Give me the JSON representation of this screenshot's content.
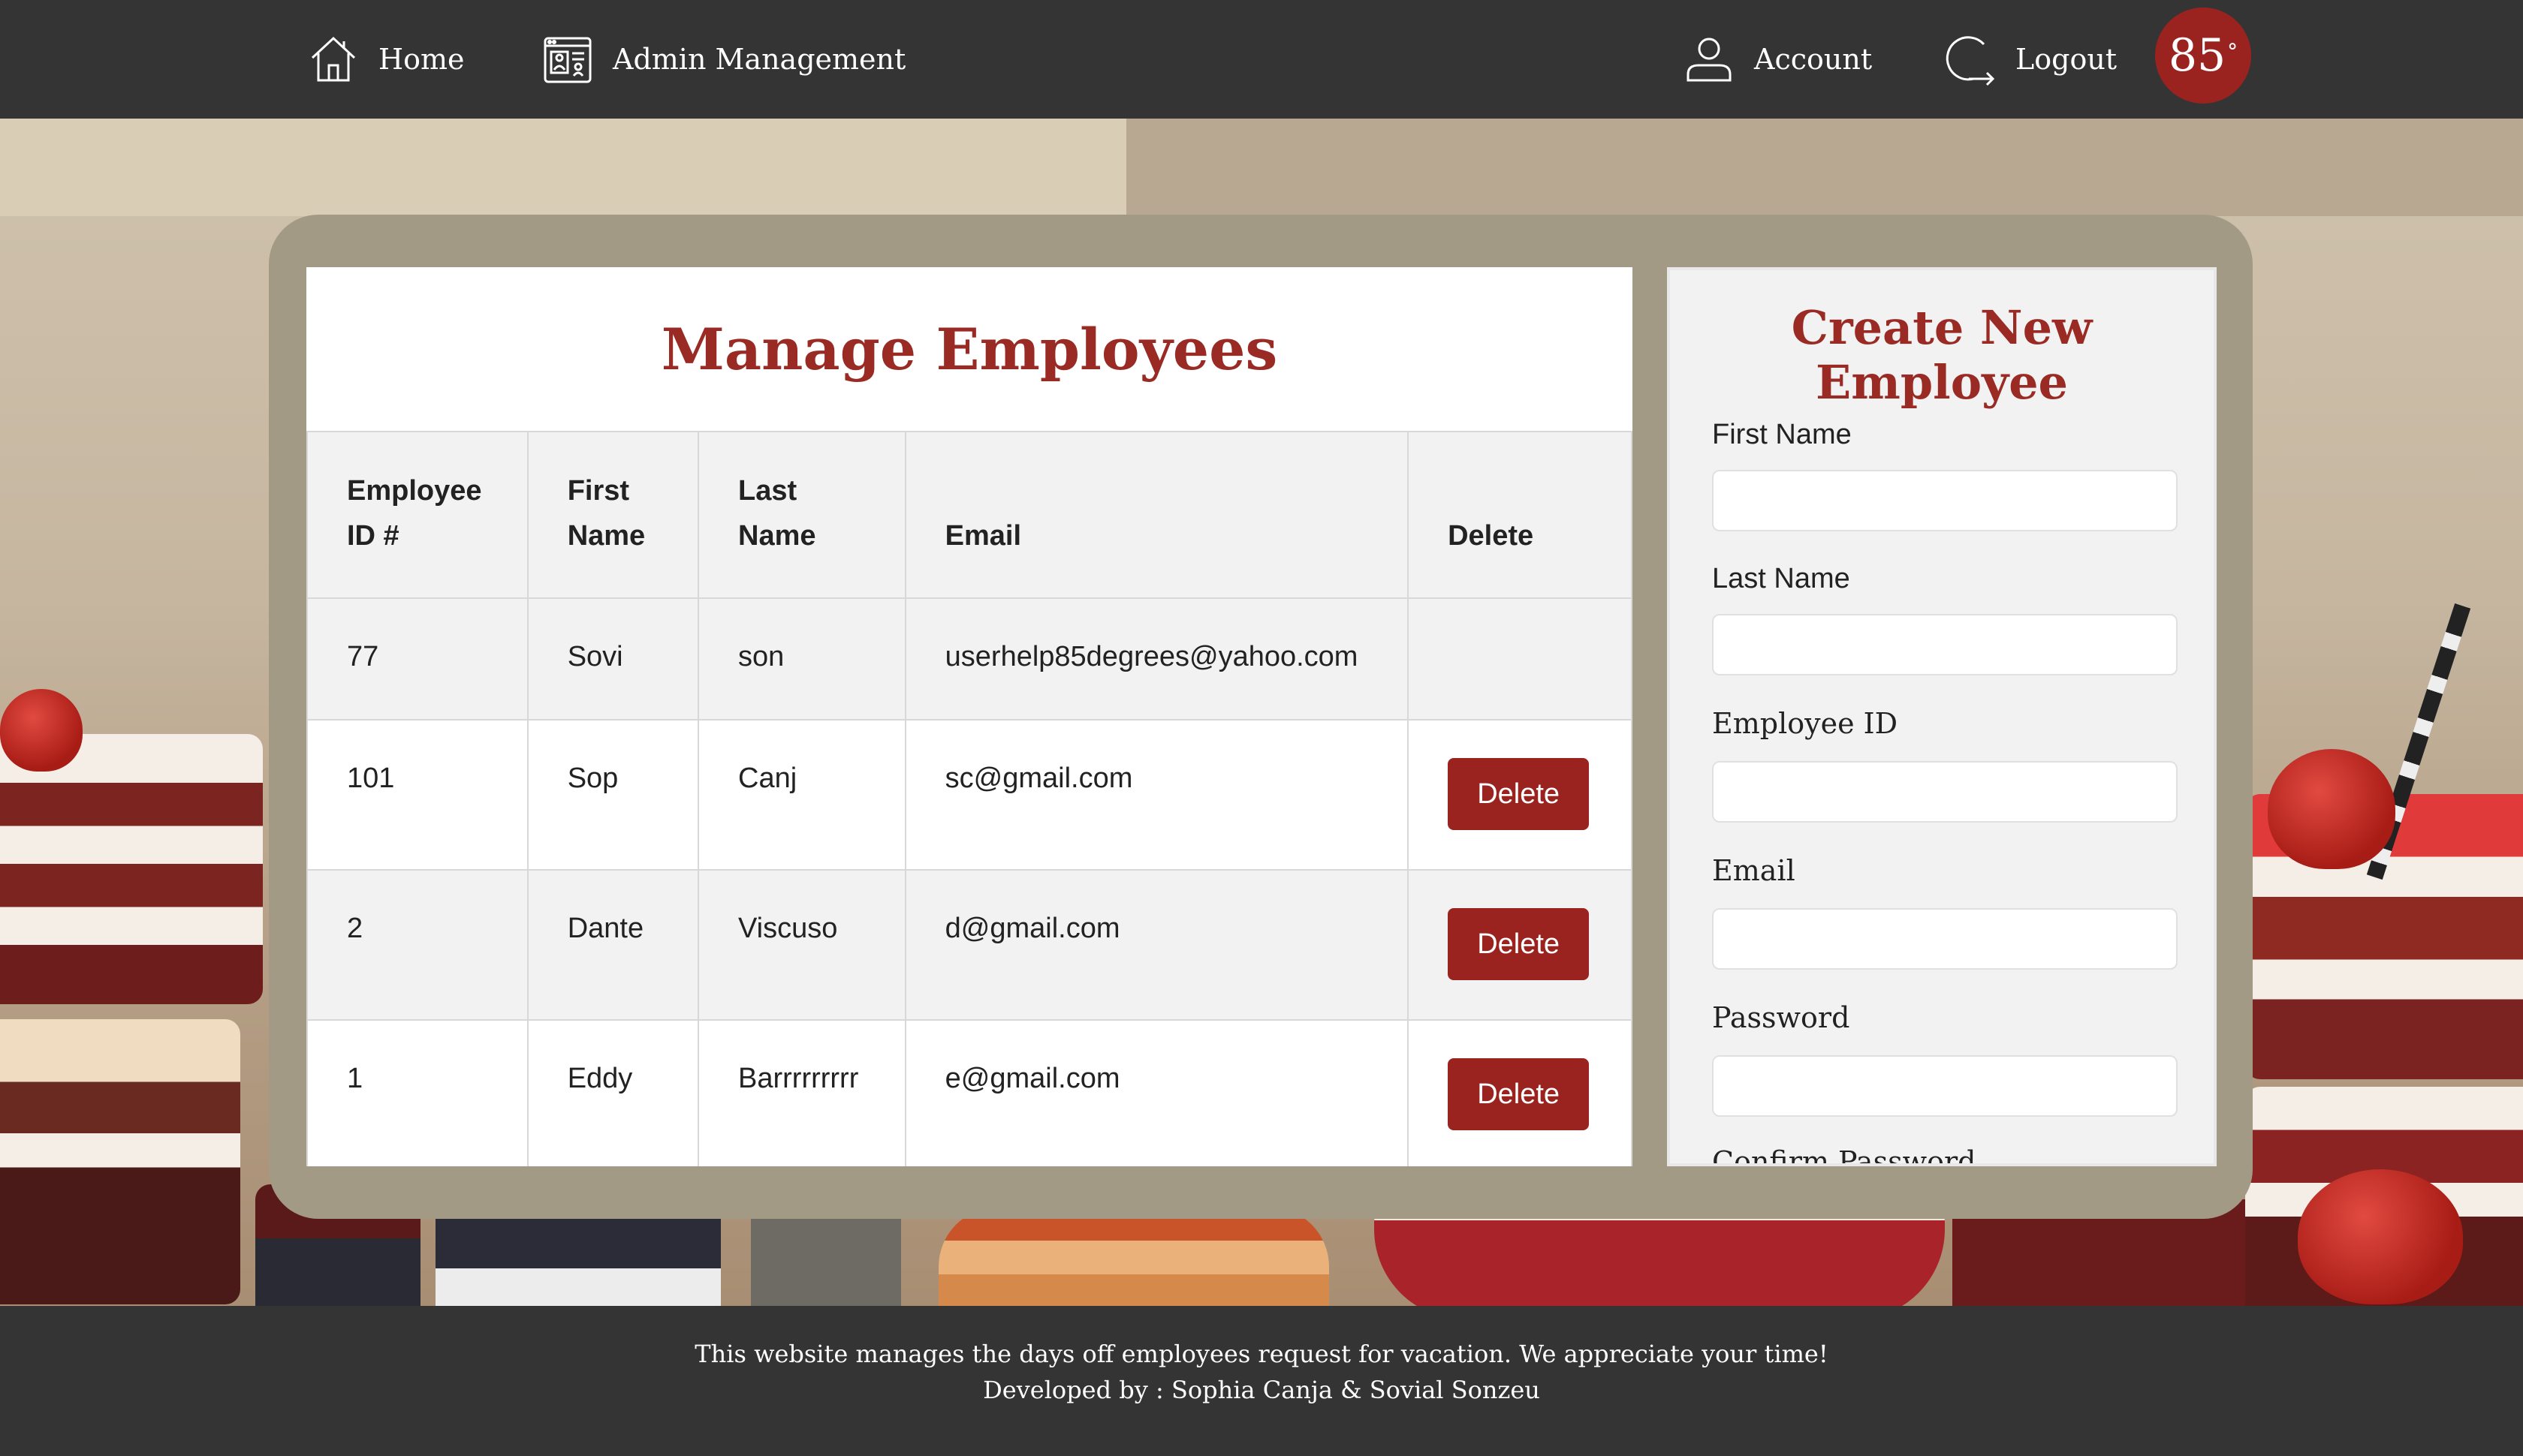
{
  "nav": {
    "home_label": "Home",
    "admin_label": "Admin Management",
    "account_label": "Account",
    "logout_label": "Logout",
    "logo_text": "85",
    "logo_sup": "°"
  },
  "table": {
    "title": "Manage Employees",
    "headers": {
      "id_line1": "Employee",
      "id_line2": "ID #",
      "first_line1": "First",
      "first_line2": "Name",
      "last_line1": "Last",
      "last_line2": "Name",
      "email": "Email",
      "delete": "Delete"
    },
    "rows": [
      {
        "id": "77",
        "first": "Sovi",
        "last": "son",
        "email": "userhelp85degrees@yahoo.com",
        "delete": ""
      },
      {
        "id": "101",
        "first": "Sop",
        "last": "Canj",
        "email": "sc@gmail.com",
        "delete": "Delete"
      },
      {
        "id": "2",
        "first": "Dante",
        "last": "Viscuso",
        "email": "d@gmail.com",
        "delete": "Delete"
      },
      {
        "id": "1",
        "first": "Eddy",
        "last": "Barrrrrrrrr",
        "email": "e@gmail.com",
        "delete": "Delete"
      }
    ]
  },
  "form": {
    "title": "Create New Employee",
    "first_name_label": "First Name",
    "last_name_label": "Last Name",
    "employee_id_label": "Employee ID",
    "email_label": "Email",
    "password_label": "Password",
    "confirm_password_label": "Confirm Password"
  },
  "footer": {
    "line1": "This website manages the days off employees request for vacation. We appreciate your time!",
    "line2": "Developed by : Sophia Canja & Sovial Sonzeu"
  },
  "colors": {
    "accent": "#9a2320",
    "nav_bg": "#343434",
    "panel_bg": "#a39a86"
  }
}
